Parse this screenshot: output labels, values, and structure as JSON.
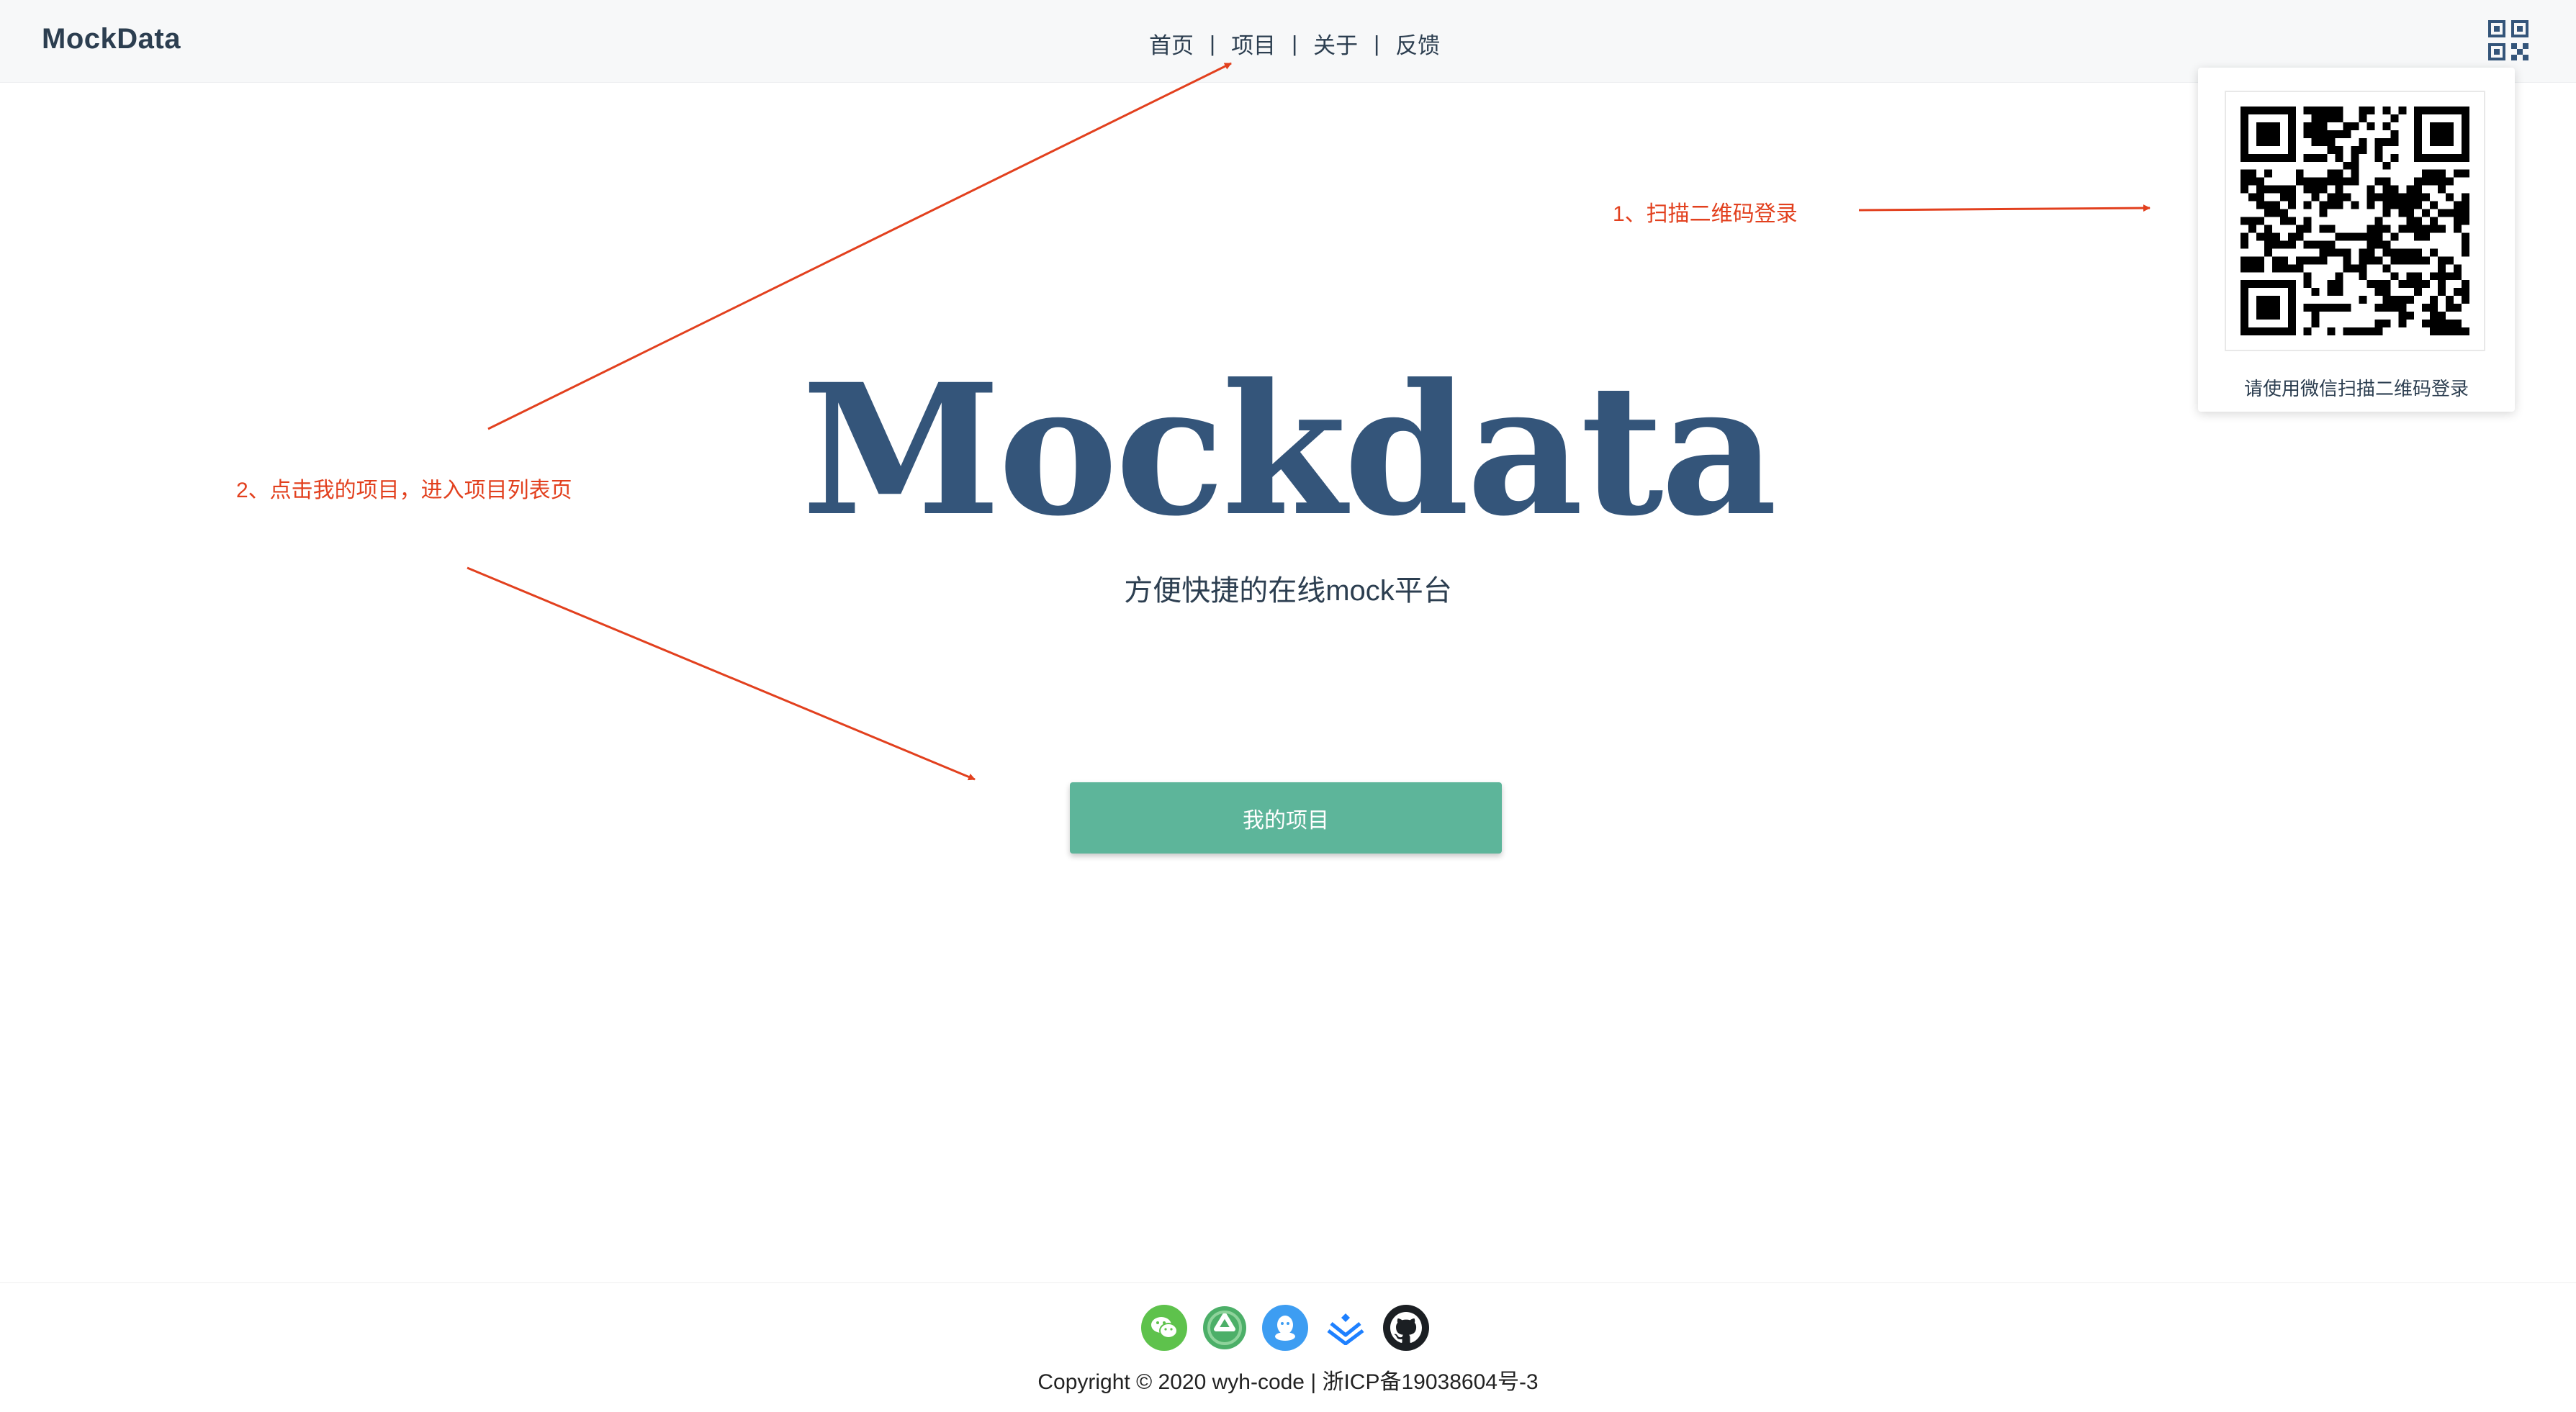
{
  "header": {
    "logo": "MockData",
    "nav": [
      {
        "label": "首页"
      },
      {
        "label": "项目"
      },
      {
        "label": "关于"
      },
      {
        "label": "反馈"
      }
    ],
    "separator": "|",
    "qr_toggle_icon": "qrcode-icon"
  },
  "qr_popover": {
    "caption": "请使用微信扫描二维码登录"
  },
  "annotations": {
    "step1": "1、扫描二维码登录",
    "step2": "2、点击我的项目，进入项目列表页",
    "color": "#e2401e"
  },
  "hero": {
    "title": "Mockdata",
    "subtitle": "方便快捷的在线mock平台",
    "button": "我的项目",
    "title_color": "#34557a",
    "button_color": "#5db59a"
  },
  "footer": {
    "icons": [
      "wechat-icon",
      "recycle-icon",
      "qq-icon",
      "juejin-icon",
      "github-icon"
    ],
    "copyright": "Copyright © 2020 wyh-code | 浙ICP备19038604号-3"
  }
}
